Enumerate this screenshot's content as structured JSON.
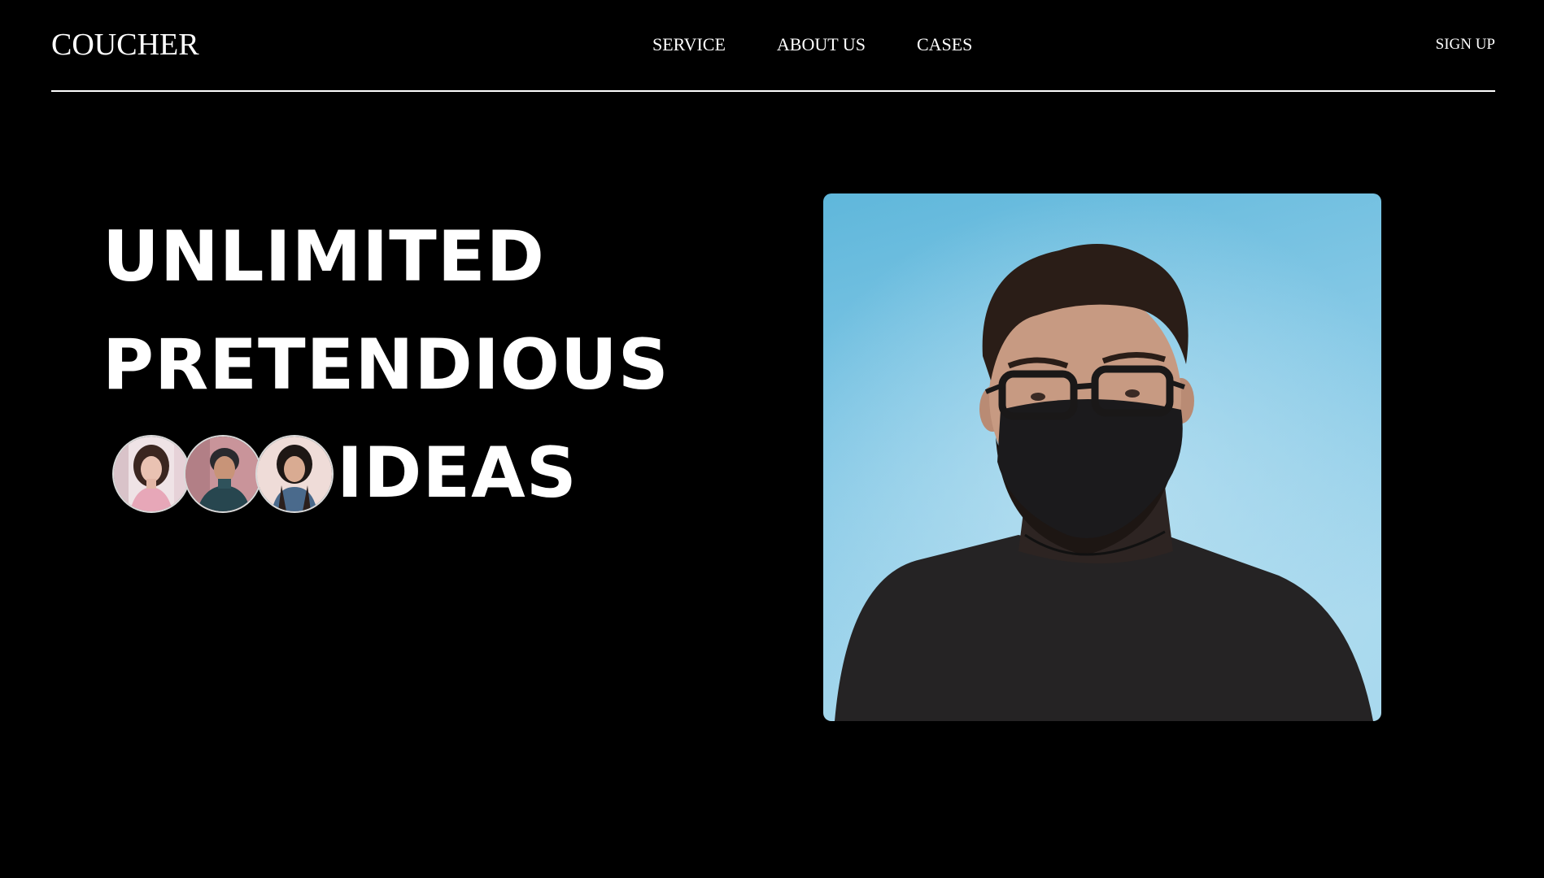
{
  "header": {
    "logo": "COUCHER",
    "nav": [
      {
        "label": "SERVICE"
      },
      {
        "label": "ABOUT US"
      },
      {
        "label": "CASES"
      }
    ],
    "signup_label": "SIGN UP"
  },
  "hero": {
    "lines": [
      "UNLIMITED",
      "PRETENDIOUS",
      "IDEAS"
    ],
    "avatars": [
      {
        "name": "avatar-woman-pink-icon"
      },
      {
        "name": "avatar-boy-teal-icon"
      },
      {
        "name": "avatar-woman-denim-icon"
      }
    ],
    "image": {
      "subject": "man-with-face-mask-photo",
      "background_color": "#7cc4e3"
    }
  },
  "colors": {
    "background": "#000000",
    "text": "#ffffff",
    "divider": "#ffffff",
    "photo_sky": "#7cc4e3"
  }
}
